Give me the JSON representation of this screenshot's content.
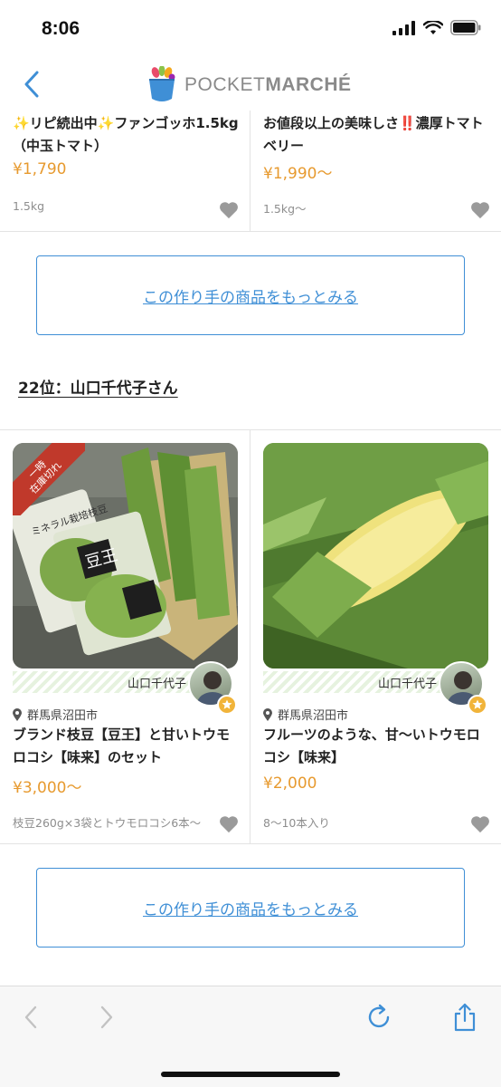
{
  "status_bar": {
    "time": "8:06"
  },
  "header": {
    "logo_light": "POCKET",
    "logo_bold": "MARCHÉ"
  },
  "top_products": [
    {
      "title": "✨リピ続出中✨ファンゴッホ1.5kg（中玉トマト）",
      "price": "¥1,790",
      "spec": "1.5kg"
    },
    {
      "title": "お値段以上の美味しさ‼️濃厚トマトベリー",
      "price": "¥1,990〜",
      "spec": "1.5kg〜"
    }
  ],
  "more_button_label": "この作り手の商品をもっとみる",
  "rank_heading": "22位：山口千代子さん",
  "products": [
    {
      "badge": [
        "一時",
        "在庫切れ"
      ],
      "image_labels": [
        "ミネラル栽培枝豆",
        "豆王"
      ],
      "producer": "山口千代子",
      "location": "群馬県沼田市",
      "title": "ブランド枝豆【豆王】と甘いトウモロコシ【味来】のセット",
      "price": "¥3,000〜",
      "spec": "枝豆260g×3袋とトウモロコシ6本〜"
    },
    {
      "producer": "山口千代子",
      "location": "群馬県沼田市",
      "title": "フルーツのような、甘〜いトウモロコシ【味来】",
      "price": "¥2,000",
      "spec": "8〜10本入り"
    }
  ],
  "colors": {
    "accent_blue": "#3f8fd6",
    "price_orange": "#e79a2f",
    "badge_red": "#c0392b"
  }
}
